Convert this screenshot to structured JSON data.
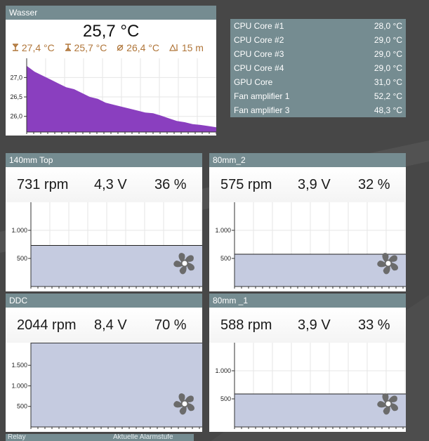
{
  "water": {
    "title": "Wasser",
    "main_value": "25,7 °C",
    "max": "27,4 °C",
    "min": "25,7 °C",
    "avg": "26,4 °C",
    "span": "15 m",
    "yticks": [
      "27,0",
      "26,5",
      "26,0"
    ],
    "series": [
      27.3,
      27.15,
      27.05,
      26.95,
      26.85,
      26.75,
      26.7,
      26.6,
      26.5,
      26.45,
      26.35,
      26.3,
      26.25,
      26.2,
      26.15,
      26.1,
      26.08,
      26.02,
      25.95,
      25.88,
      25.85,
      25.8,
      25.78,
      25.75,
      25.72
    ]
  },
  "sensors": [
    {
      "name": "CPU Core #1",
      "value": "28,0 °C"
    },
    {
      "name": "CPU Core #2",
      "value": "29,0 °C"
    },
    {
      "name": "CPU Core #3",
      "value": "29,0 °C"
    },
    {
      "name": "CPU Core #4",
      "value": "29,0 °C"
    },
    {
      "name": "GPU Core",
      "value": "31,0 °C"
    },
    {
      "name": "Fan amplifier 1",
      "value": "52,2 °C"
    },
    {
      "name": "Fan amplifier 3",
      "value": "48,3 °C"
    }
  ],
  "fans": [
    {
      "title": "140mm Top",
      "rpm": "731 rpm",
      "volt": "4,3 V",
      "pct": "36 %",
      "yticks": [
        "1.000",
        "500"
      ],
      "level": 731,
      "ymax": 1500
    },
    {
      "title": "80mm_2",
      "rpm": "575 rpm",
      "volt": "3,9 V",
      "pct": "32 %",
      "yticks": [
        "1.000",
        "500"
      ],
      "level": 575,
      "ymax": 1500
    },
    {
      "title": "DDC",
      "rpm": "2044 rpm",
      "volt": "8,4 V",
      "pct": "70 %",
      "yticks": [
        "1.500",
        "1.000",
        "500"
      ],
      "level": 2044,
      "ymax": 2050
    },
    {
      "title": "80mm _1",
      "rpm": "588 rpm",
      "volt": "3,9 V",
      "pct": "33 %",
      "yticks": [
        "1.000",
        "500"
      ],
      "level": 588,
      "ymax": 1500
    }
  ],
  "bottom": {
    "label1": "Relay",
    "label2": "Aktuelle Alarmstufe"
  },
  "colors": {
    "titlebar": "#758c91",
    "water_fill": "#8a3fbf",
    "fan_fill": "#c5cbe0",
    "sub_text": "#b0763a"
  },
  "icons": {
    "max": "max-temp-icon",
    "min": "min-temp-icon",
    "avg": "average-icon",
    "span": "timespan-icon",
    "fan": "fan-icon"
  }
}
